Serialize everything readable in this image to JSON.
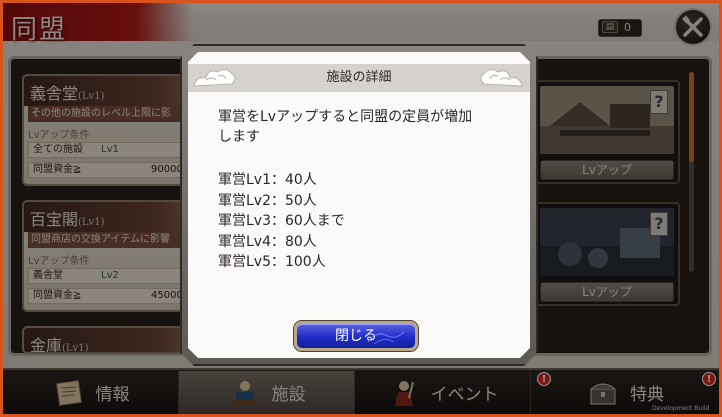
{
  "header": {
    "title": "同盟",
    "currency_value": "0",
    "currency_icon": "treasure-chest-icon"
  },
  "cards": [
    {
      "name": "義舎堂",
      "level": "(Lv1)",
      "description": "その他の施設のレベル上限に影",
      "req_label": "Lvアップ条件",
      "req1": {
        "label": "全ての施設",
        "value": "Lv1"
      },
      "req2": {
        "label": "同盟資金≧",
        "value": "90000"
      }
    },
    {
      "name": "百宝閣",
      "level": "(Lv1)",
      "description": "同盟商店の交換アイテムに影響",
      "req_label": "Lvアップ条件",
      "req1": {
        "label": "義舎堂",
        "value": "Lv2"
      },
      "req2": {
        "label": "同盟資金≧",
        "value": "45000"
      }
    },
    {
      "name": "金庫",
      "level": "(Lv1)"
    }
  ],
  "side_buttons": [
    "Lvアップ",
    "Lvアップ"
  ],
  "dialog": {
    "title": "施設の詳細",
    "body_line1": "軍営をLvアップすると同盟の定員が増加",
    "body_line2": "します",
    "levels": [
      "軍営Lv1：40人",
      "軍営Lv2：50人",
      "軍営Lv3：60人まで",
      "軍営Lv4：80人",
      "軍営Lv5：100人"
    ],
    "close_label": "閉じる"
  },
  "tabs": [
    {
      "label": "情報",
      "icon": "scroll-icon",
      "active": false,
      "badge": ""
    },
    {
      "label": "施設",
      "icon": "officer-icon",
      "active": true,
      "badge": ""
    },
    {
      "label": "イベント",
      "icon": "warrior-icon",
      "active": false,
      "badge": "!"
    },
    {
      "label": "特典",
      "icon": "chest-icon",
      "active": false,
      "badge": "!"
    }
  ],
  "footer": {
    "build_label": "Development Build"
  },
  "colors": {
    "accent_red": "#b21a17",
    "button_blue": "#1f2cc7",
    "badge_red": "#d42a1c",
    "frame_orange": "#d9531c"
  }
}
